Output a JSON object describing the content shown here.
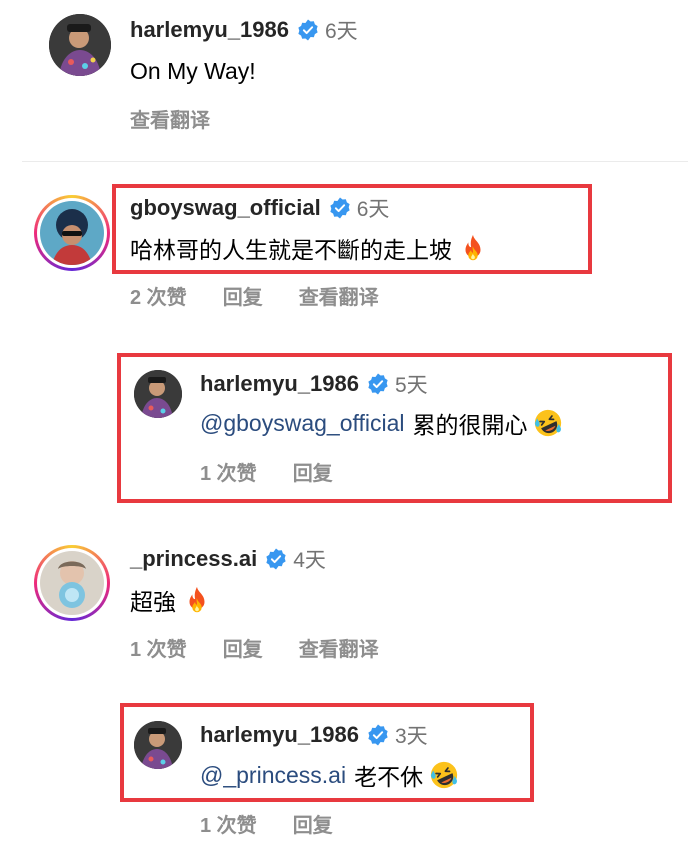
{
  "comments": [
    {
      "username": "harlemyu_1986",
      "time": "6天",
      "text": "On My Way!",
      "actions": {
        "translate": "查看翻译"
      }
    },
    {
      "username": "gboyswag_official",
      "time": "6天",
      "text": "哈林哥的人生就是不斷的走上坡",
      "emoji": "fire-emoji",
      "actions": {
        "likes": "2 次赞",
        "reply": "回复",
        "translate": "查看翻译"
      }
    },
    {
      "username": "harlemyu_1986",
      "time": "5天",
      "mention": "@gboyswag_official",
      "text": "累的很開心",
      "emoji": "rofl-emoji",
      "actions": {
        "likes": "1 次赞",
        "reply": "回复"
      }
    },
    {
      "username": "_princess.ai",
      "time": "4天",
      "text": "超強",
      "emoji": "fire-emoji",
      "actions": {
        "likes": "1 次赞",
        "reply": "回复",
        "translate": "查看翻译"
      }
    },
    {
      "username": "harlemyu_1986",
      "time": "3天",
      "mention": "@_princess.ai",
      "text": "老不休",
      "emoji": "rofl-emoji",
      "actions": {
        "likes": "1 次赞",
        "reply": "回复"
      }
    }
  ],
  "colors": {
    "highlight": "#e8393f",
    "verified": "#3897f0",
    "mention": "#2b4c7e",
    "meta": "#8e8e8e"
  }
}
